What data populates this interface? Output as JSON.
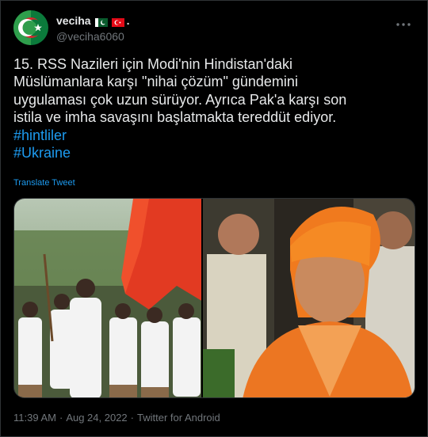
{
  "author": {
    "display_name": "veciha",
    "name_suffix": ".",
    "handle": "@veciha6060",
    "avatar_icon": "crescent-star-avatar-icon"
  },
  "tweet": {
    "lines": [
      "15. RSS Nazileri için Modi'nin Hindistan'daki",
      "Müslümanlara karşı \"nihai çözüm\" gündemini",
      "uygulaması çok uzun sürüyor. Ayrıca Pak'a karşı son",
      "istila ve imha savaşını başlatmakta tereddüt ediyor."
    ],
    "hashtags": [
      "#hintliler",
      "#Ukraine"
    ],
    "translate_label": "Translate Tweet"
  },
  "meta": {
    "time": "11:39 AM",
    "separator": "·",
    "date": "Aug 24, 2022",
    "source": "Twitter for Android"
  },
  "colors": {
    "background": "#000000",
    "text": "#e7e9ea",
    "muted": "#71767b",
    "link": "#1d9bf0",
    "border": "#2f3336"
  }
}
